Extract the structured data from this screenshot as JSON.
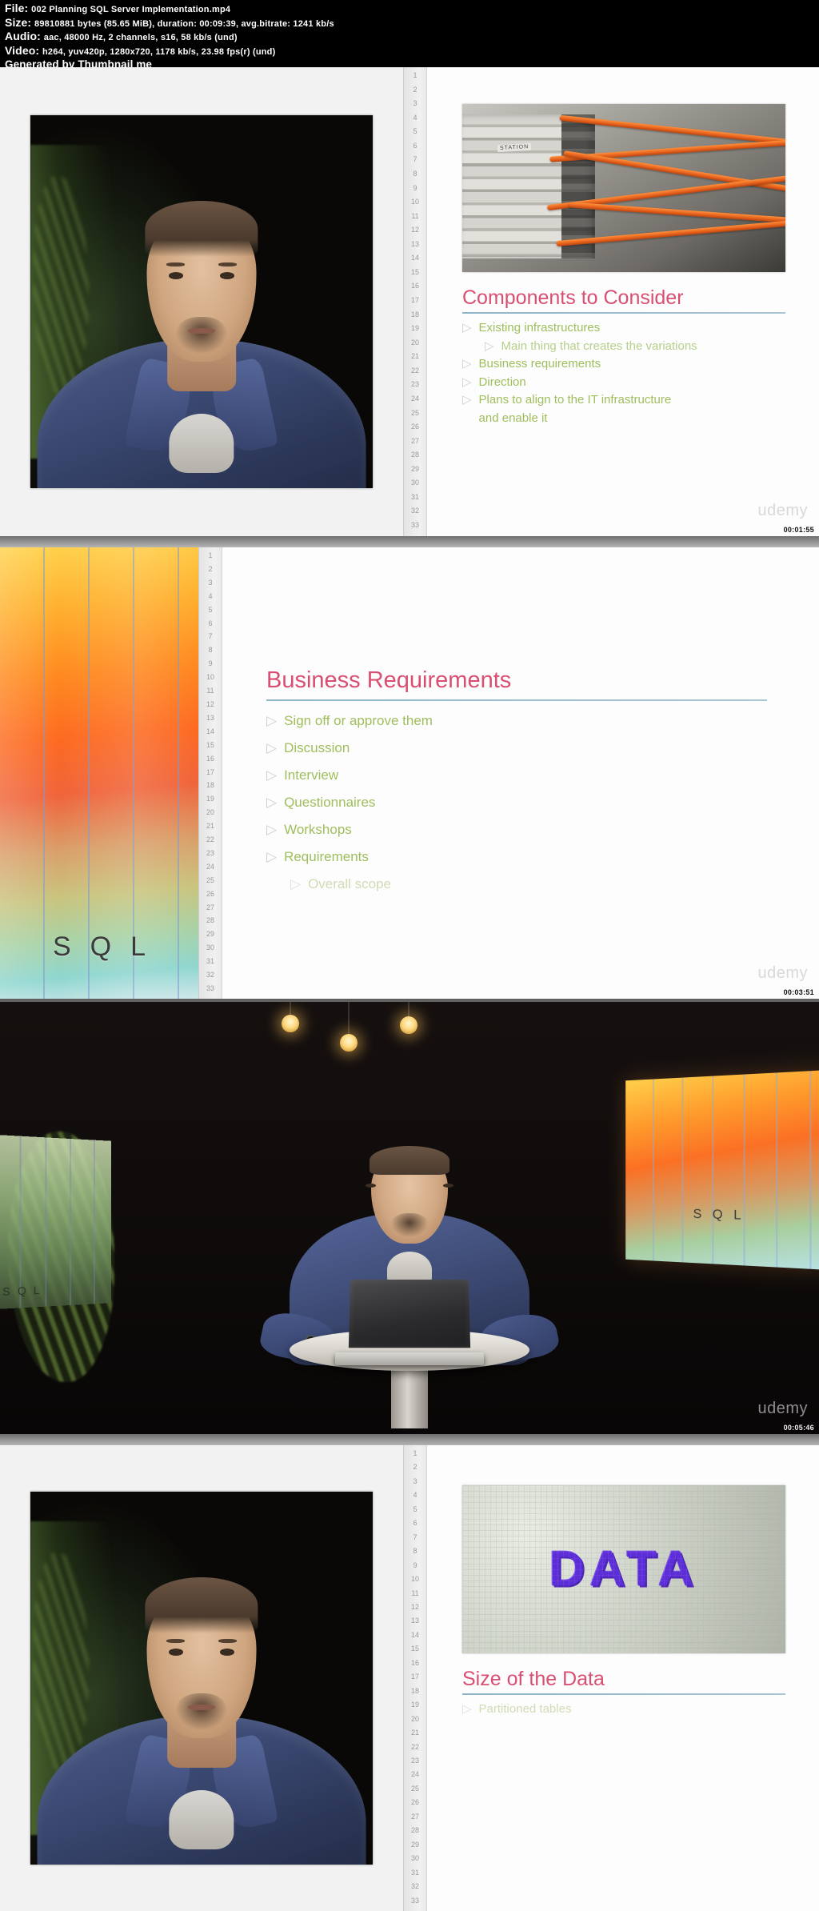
{
  "header": {
    "file_label": "File:",
    "file_value": "002 Planning SQL Server Implementation.mp4",
    "size_label": "Size:",
    "size_value": "89810881 bytes (85.65 MiB), duration: 00:09:39, avg.bitrate: 1241 kb/s",
    "audio_label": "Audio:",
    "audio_value": "aac, 48000 Hz, 2 channels, s16, 58 kb/s (und)",
    "video_label": "Video:",
    "video_value": "h264, yuv420p, 1280x720, 1178 kb/s, 23.98 fps(r) (und)",
    "generated_by": "Generated by Thumbnail me"
  },
  "ruler": {
    "numbers": [
      1,
      2,
      3,
      4,
      5,
      6,
      7,
      8,
      9,
      10,
      11,
      12,
      13,
      14,
      15,
      16,
      17,
      18,
      19,
      20,
      21,
      22,
      23,
      24,
      25,
      26,
      27,
      28,
      29,
      30,
      31,
      32,
      33
    ]
  },
  "watermark": "udemy",
  "thumbnails": [
    {
      "index": 1,
      "kind": "slide",
      "timestamp": "00:01:55",
      "picture_caption": "STATION",
      "slide": {
        "title": "Components to Consider",
        "bullets": [
          {
            "text": "Existing infrastructures",
            "level": 1
          },
          {
            "text": "Main thing that creates the variations",
            "level": 2
          },
          {
            "text": "Business requirements",
            "level": 1
          },
          {
            "text": "Direction",
            "level": 1
          },
          {
            "text": "Plans to align to the IT infrastructure",
            "level": 1
          },
          {
            "text": "and enable it",
            "level": 1,
            "continuation": true
          }
        ]
      }
    },
    {
      "index": 2,
      "kind": "slide",
      "timestamp": "00:03:51",
      "side_panel_text": "SQL",
      "slide": {
        "title": "Business Requirements",
        "bullets": [
          {
            "text": "Sign off or approve them",
            "level": 1
          },
          {
            "text": "Discussion",
            "level": 1
          },
          {
            "text": "Interview",
            "level": 1
          },
          {
            "text": "Questionnaires",
            "level": 1
          },
          {
            "text": "Workshops",
            "level": 1
          },
          {
            "text": "Requirements",
            "level": 1
          },
          {
            "text": "Overall scope",
            "level": 2,
            "faint": true
          }
        ]
      }
    },
    {
      "index": 3,
      "kind": "video",
      "timestamp": "00:05:46",
      "screen_right_text": "SQL",
      "screen_left_text": "SQL"
    },
    {
      "index": 4,
      "kind": "slide",
      "timestamp": "",
      "picture_caption": "DATA",
      "slide": {
        "title": "Size of the Data",
        "bullets": [
          {
            "text": "Partitioned tables",
            "level": 1,
            "faint": true
          }
        ]
      }
    }
  ],
  "colors": {
    "title_pink": "#d94f72",
    "bullet_green": "#9fbe5c",
    "rule_blue": "#8fb5c9",
    "background_black": "#000000",
    "data_purple": "#5b2fd6"
  },
  "icons": {
    "bullet": "▷"
  }
}
